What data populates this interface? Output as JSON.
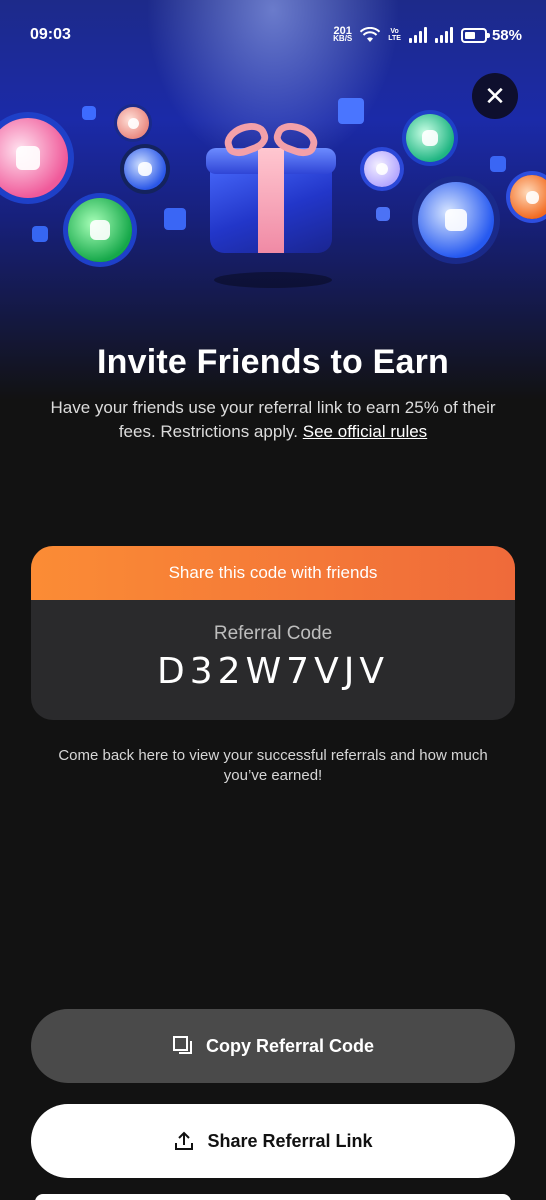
{
  "status_bar": {
    "time": "09:03",
    "net_speed_value": "201",
    "net_speed_unit": "KB/S",
    "volte_top": "Vo",
    "volte_bottom": "LTE",
    "battery": "58%",
    "battery_level": 0.58
  },
  "header": {
    "close_icon": "close-icon",
    "hero_icon": "gift-icon"
  },
  "main": {
    "title": "Invite Friends to Earn",
    "subtitle": "Have your friends use your referral link to earn 25% of their fees. Restrictions apply.",
    "rules_link": "See official rules"
  },
  "code_card": {
    "header": "Share this code with friends",
    "label": "Referral Code",
    "code": "D32W7VJV"
  },
  "note": "Come back here to view your successful referrals and how much you’ve earned!",
  "actions": {
    "copy_label": "Copy Referral Code",
    "copy_icon": "copy-icon",
    "share_label": "Share Referral Link",
    "share_icon": "share-icon"
  },
  "colors": {
    "accent_orange": "#fb8c35",
    "hero_blue": "#1b2aa8",
    "background": "#121212"
  }
}
